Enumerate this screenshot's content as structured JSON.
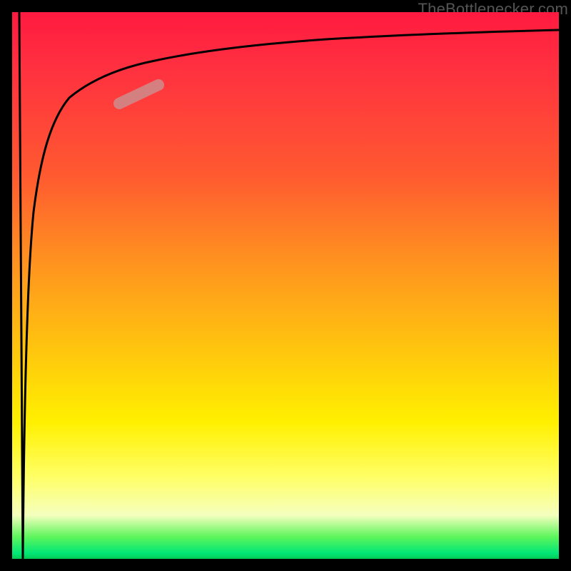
{
  "watermark": "TheBottlenecker.com",
  "chart_data": {
    "type": "line",
    "title": "",
    "xlabel": "",
    "ylabel": "",
    "xlim": [
      0,
      100
    ],
    "ylim": [
      0,
      100
    ],
    "gradient_meaning": "background color encodes bottleneck severity: green = good (low), red = bad (high)",
    "series": [
      {
        "name": "bottleneck-curve",
        "comment": "x is normalized GPU/CPU ratio axis, y is bottleneck % (100 = max red, 0 = green)",
        "x": [
          0,
          1,
          1.2,
          1.5,
          2,
          3,
          4,
          6,
          8,
          10,
          14,
          20,
          30,
          45,
          60,
          80,
          100
        ],
        "y": [
          100,
          0,
          20,
          55,
          70,
          79,
          83,
          86,
          88,
          89.5,
          91,
          92.5,
          94,
          95,
          95.8,
          96.2,
          96.5
        ]
      }
    ],
    "marker": {
      "comment": "highlighted pill segment on the curve (rough operating point)",
      "x_range": [
        18,
        26
      ],
      "y_range": [
        86,
        90
      ]
    }
  }
}
